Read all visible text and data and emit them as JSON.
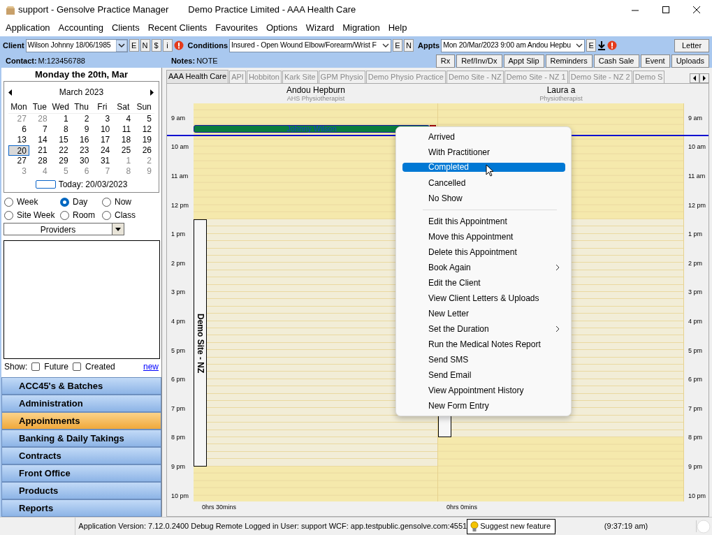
{
  "window": {
    "title": "support - Gensolve Practice Manager",
    "subtitle": "Demo Practice Limited  - AAA Health Care"
  },
  "menu": [
    "Application",
    "Accounting",
    "Clients",
    "Recent Clients",
    "Favourites",
    "Options",
    "Wizard",
    "Migration",
    "Help"
  ],
  "toolbar": {
    "client": {
      "label": "Client",
      "value": "Wilson Johnny 18/06/1985",
      "buttons": [
        "E",
        "N",
        "$",
        "i"
      ],
      "alert": true
    },
    "conditions": {
      "label": "Conditions",
      "value": "Insured - Open Wound Elbow/Forearm/Wrist F",
      "buttons": [
        "E",
        "N"
      ]
    },
    "appts": {
      "label": "Appts",
      "value": "Mon 20/Mar/2023  9:00 am Andou Hepbu",
      "buttons": [
        "E"
      ],
      "alert": true
    },
    "letter_button": "Letter",
    "contact": {
      "label": "Contact:",
      "value": "M:123456788"
    },
    "notes": {
      "label": "Notes:",
      "value": "NOTE"
    },
    "buttons": [
      "Rx",
      "Ref/Inv/Dx",
      "Appt Slip",
      "Reminders",
      "Cash Sale",
      "Event",
      "Uploads"
    ]
  },
  "sidebar": {
    "date_heading": "Monday the 20th, Mar",
    "calendar": {
      "month": "March 2023",
      "weekdays": [
        "Mon",
        "Tue",
        "Wed",
        "Thu",
        "Fri",
        "Sat",
        "Sun"
      ],
      "days": [
        {
          "day": "27",
          "muted": true,
          "selected": false
        },
        {
          "day": "28",
          "muted": true,
          "selected": false
        },
        {
          "day": "1",
          "muted": false,
          "selected": false
        },
        {
          "day": "2",
          "muted": false,
          "selected": false
        },
        {
          "day": "3",
          "muted": false,
          "selected": false
        },
        {
          "day": "4",
          "muted": false,
          "selected": false
        },
        {
          "day": "5",
          "muted": false,
          "selected": false
        },
        {
          "day": "6",
          "muted": false,
          "selected": false
        },
        {
          "day": "7",
          "muted": false,
          "selected": false
        },
        {
          "day": "8",
          "muted": false,
          "selected": false
        },
        {
          "day": "9",
          "muted": false,
          "selected": false
        },
        {
          "day": "10",
          "muted": false,
          "selected": false
        },
        {
          "day": "11",
          "muted": false,
          "selected": false
        },
        {
          "day": "12",
          "muted": false,
          "selected": false
        },
        {
          "day": "13",
          "muted": false,
          "selected": false
        },
        {
          "day": "14",
          "muted": false,
          "selected": false
        },
        {
          "day": "15",
          "muted": false,
          "selected": false
        },
        {
          "day": "16",
          "muted": false,
          "selected": false
        },
        {
          "day": "17",
          "muted": false,
          "selected": false
        },
        {
          "day": "18",
          "muted": false,
          "selected": false
        },
        {
          "day": "19",
          "muted": false,
          "selected": false
        },
        {
          "day": "20",
          "muted": false,
          "selected": true
        },
        {
          "day": "21",
          "muted": false,
          "selected": false
        },
        {
          "day": "22",
          "muted": false,
          "selected": false
        },
        {
          "day": "23",
          "muted": false,
          "selected": false
        },
        {
          "day": "24",
          "muted": false,
          "selected": false
        },
        {
          "day": "25",
          "muted": false,
          "selected": false
        },
        {
          "day": "26",
          "muted": false,
          "selected": false
        },
        {
          "day": "27",
          "muted": false,
          "selected": false
        },
        {
          "day": "28",
          "muted": false,
          "selected": false
        },
        {
          "day": "29",
          "muted": false,
          "selected": false
        },
        {
          "day": "30",
          "muted": false,
          "selected": false
        },
        {
          "day": "31",
          "muted": false,
          "selected": false
        },
        {
          "day": "1",
          "muted": true,
          "selected": false
        },
        {
          "day": "2",
          "muted": true,
          "selected": false
        },
        {
          "day": "3",
          "muted": true,
          "selected": false
        },
        {
          "day": "4",
          "muted": true,
          "selected": false
        },
        {
          "day": "5",
          "muted": true,
          "selected": false
        },
        {
          "day": "6",
          "muted": true,
          "selected": false
        },
        {
          "day": "7",
          "muted": true,
          "selected": false
        },
        {
          "day": "8",
          "muted": true,
          "selected": false
        },
        {
          "day": "9",
          "muted": true,
          "selected": false
        }
      ],
      "today": "Today: 20/03/2023"
    },
    "view_options": [
      {
        "label": "Week",
        "selected": false
      },
      {
        "label": "Day",
        "selected": true
      },
      {
        "label": "Now",
        "selected": false
      },
      {
        "label": "Site Week",
        "selected": false
      },
      {
        "label": "Room",
        "selected": false
      },
      {
        "label": "Class",
        "selected": false
      }
    ],
    "providers_dropdown": "Providers",
    "show": {
      "label": "Show:",
      "options": [
        {
          "label": "Future",
          "checked": false
        },
        {
          "label": "Created",
          "checked": false
        }
      ],
      "link": "new"
    },
    "nav": [
      {
        "label": "ACC45's & Batches",
        "selected": false
      },
      {
        "label": "Administration",
        "selected": false
      },
      {
        "label": "Appointments",
        "selected": true
      },
      {
        "label": "Banking & Daily Takings",
        "selected": false
      },
      {
        "label": "Contracts",
        "selected": false
      },
      {
        "label": "Front Office",
        "selected": false
      },
      {
        "label": "Products",
        "selected": false
      },
      {
        "label": "Reports",
        "selected": false
      }
    ]
  },
  "scheduler": {
    "tabs": [
      {
        "label": "AAA Health Care",
        "selected": true
      },
      {
        "label": "API",
        "selected": false
      },
      {
        "label": "Hobbiton",
        "selected": false
      },
      {
        "label": "Kark Site",
        "selected": false
      },
      {
        "label": "GPM Physio",
        "selected": false
      },
      {
        "label": "Demo Physio Practice",
        "selected": false
      },
      {
        "label": "Demo Site - NZ",
        "selected": false
      },
      {
        "label": "Demo Site - NZ 1",
        "selected": false
      },
      {
        "label": "Demo Site - NZ 2",
        "selected": false
      },
      {
        "label": "Demo S",
        "selected": false
      }
    ],
    "columns": [
      {
        "name": "Andou Hepburn",
        "role": "AHS Physiotherapist",
        "total": "0hrs 30mins",
        "appointments": [
          {
            "kind": "booking",
            "text": "Johnny Wilson",
            "flag": true
          },
          {
            "kind": "site",
            "text": "Demo Site - NZ"
          }
        ]
      },
      {
        "name": "Laura a",
        "role": "Physiotherapist",
        "total": "0hrs 0mins",
        "appointments": [
          {
            "kind": "site"
          }
        ]
      }
    ],
    "time_axis_left": [
      "9 am",
      "10 am",
      "11 am",
      "12 pm",
      "1 pm",
      "2 pm",
      "3 pm",
      "4 pm",
      "5 pm",
      "6 pm",
      "7 pm",
      "8 pm",
      "9 pm",
      "10 pm"
    ],
    "time_axis_right": [
      "9 am",
      "10 am",
      "11 am",
      "12 pm",
      "1 pm",
      "2 pm",
      "3 pm",
      "4 pm",
      "5 pm",
      "6 pm",
      "7 pm",
      "8 pm",
      "9 pm",
      "10 pm"
    ]
  },
  "context_menu": [
    {
      "kind": "item",
      "label": "Arrived",
      "selected": false
    },
    {
      "kind": "item",
      "label": "With Practitioner",
      "selected": false
    },
    {
      "kind": "item",
      "label": "Completed",
      "selected": true
    },
    {
      "kind": "item",
      "label": "Cancelled",
      "selected": false
    },
    {
      "kind": "item",
      "label": "No Show",
      "selected": false
    },
    {
      "kind": "separator"
    },
    {
      "kind": "item",
      "label": "Edit this Appointment",
      "selected": false
    },
    {
      "kind": "item",
      "label": "Move this Appointment",
      "selected": false
    },
    {
      "kind": "item",
      "label": "Delete this Appointment",
      "selected": false
    },
    {
      "kind": "submenu",
      "label": "Book Again",
      "selected": false
    },
    {
      "kind": "item",
      "label": "Edit the Client",
      "selected": false
    },
    {
      "kind": "item",
      "label": "View Client Letters & Uploads",
      "selected": false
    },
    {
      "kind": "item",
      "label": "New Letter",
      "selected": false
    },
    {
      "kind": "submenu",
      "label": "Set the Duration",
      "selected": false
    },
    {
      "kind": "item",
      "label": "Run the Medical Notes Report",
      "selected": false
    },
    {
      "kind": "item",
      "label": "Send SMS",
      "selected": false
    },
    {
      "kind": "item",
      "label": "Send Email",
      "selected": false
    },
    {
      "kind": "item",
      "label": "View Appointment History",
      "selected": false
    },
    {
      "kind": "item",
      "label": "New Form Entry",
      "selected": false
    }
  ],
  "status_bar": {
    "info": "Application Version: 7.12.0.2400 Debug Remote  Logged in User: support WCF: app.testpublic.gensolve.com:4551",
    "suggest_button": "Suggest new feature",
    "clock": "(9:37:19 am)"
  }
}
